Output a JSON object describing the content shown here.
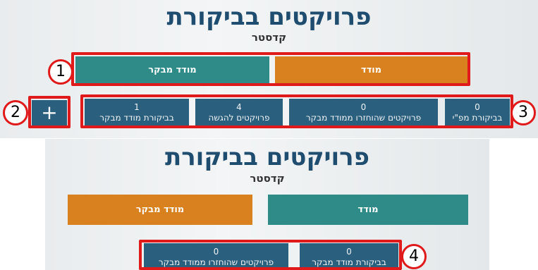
{
  "top_screen": {
    "title": "פרויקטים בביקורת",
    "subtitle": "קדסטר",
    "toggle": {
      "right_label": "מודד",
      "left_label": "מודד מבקר"
    },
    "stats": [
      {
        "count": "1",
        "label": "בביקורת מודד מבקר"
      },
      {
        "count": "4",
        "label": "פרויקטים להגשה"
      },
      {
        "count": "0",
        "label": "פרויקטים שהוחזרו ממודד מבקר"
      },
      {
        "count": "0",
        "label": "בביקורת מפ\"י"
      }
    ],
    "add_icon": "plus-icon"
  },
  "bottom_screen": {
    "title": "פרויקטים בביקורת",
    "subtitle": "קדסטר",
    "toggle": {
      "left_label": "מודד מבקר",
      "right_label": "מודד"
    },
    "stats": [
      {
        "count": "0",
        "label": "פרויקטים שהוחזרו ממודד מבקר"
      },
      {
        "count": "0",
        "label": "בביקורת מודד מבקר"
      }
    ]
  },
  "markers": [
    "1",
    "2",
    "3",
    "4"
  ],
  "colors": {
    "teal": "#2f8b88",
    "orange": "#d9801f",
    "navy": "#2b5f7e",
    "annotation_red": "#e01a1a"
  }
}
